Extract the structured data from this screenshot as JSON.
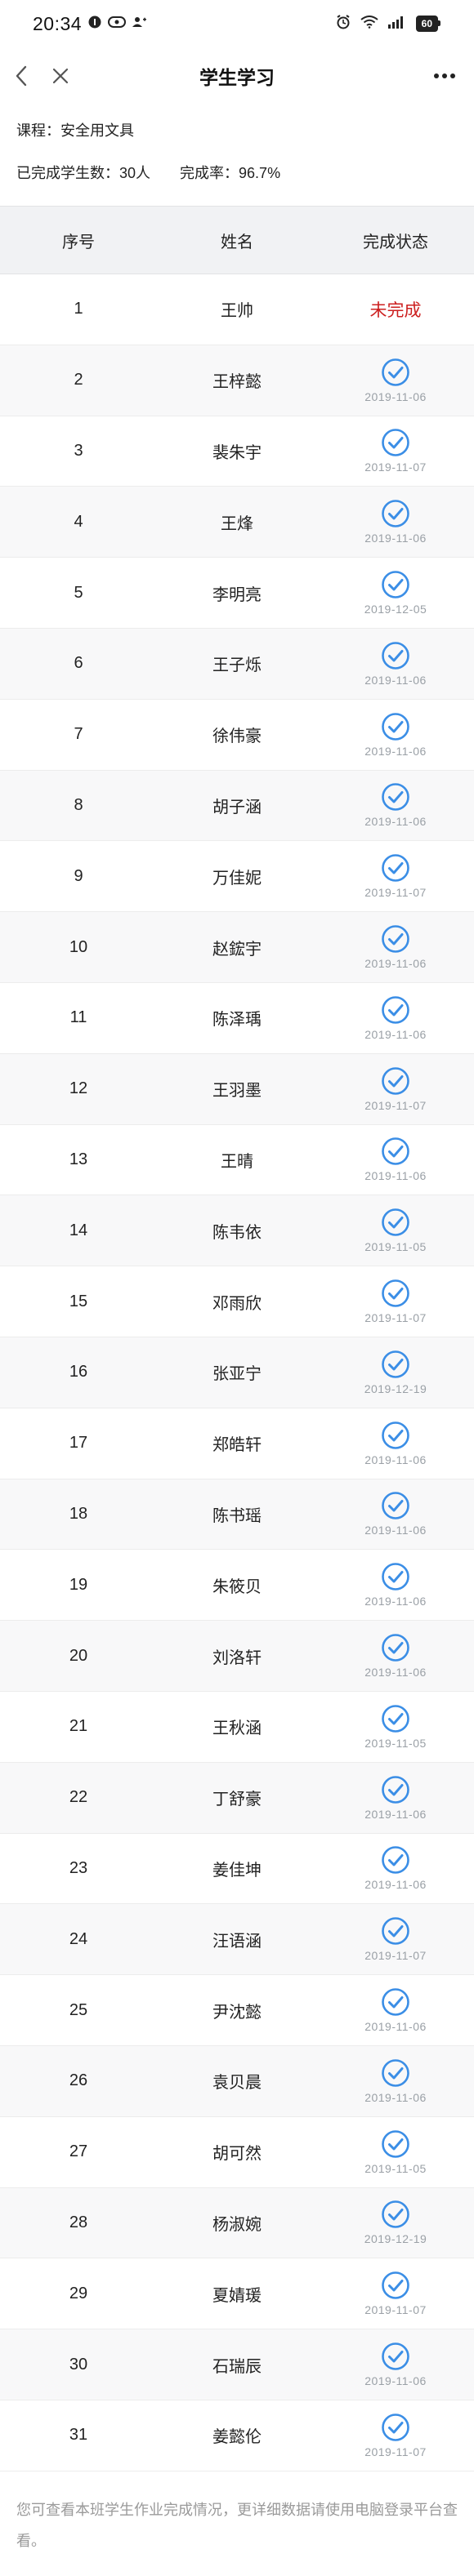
{
  "status_bar": {
    "time": "20:34",
    "battery": "60"
  },
  "nav": {
    "title": "学生学习"
  },
  "course": {
    "label": "课程：",
    "name": "安全用文具"
  },
  "summary": {
    "completed_label": "已完成学生数：",
    "completed_value": "30人",
    "rate_label": "完成率：",
    "rate_value": "96.7%"
  },
  "table": {
    "headers": {
      "no": "序号",
      "name": "姓名",
      "status": "完成状态"
    },
    "incomplete_label": "未完成",
    "rows": [
      {
        "no": "1",
        "name": "王帅",
        "done": false,
        "date": ""
      },
      {
        "no": "2",
        "name": "王梓懿",
        "done": true,
        "date": "2019-11-06"
      },
      {
        "no": "3",
        "name": "裴朱宇",
        "done": true,
        "date": "2019-11-07"
      },
      {
        "no": "4",
        "name": "王烽",
        "done": true,
        "date": "2019-11-06"
      },
      {
        "no": "5",
        "name": "李明亮",
        "done": true,
        "date": "2019-12-05"
      },
      {
        "no": "6",
        "name": "王子烁",
        "done": true,
        "date": "2019-11-06"
      },
      {
        "no": "7",
        "name": "徐伟豪",
        "done": true,
        "date": "2019-11-06"
      },
      {
        "no": "8",
        "name": "胡子涵",
        "done": true,
        "date": "2019-11-06"
      },
      {
        "no": "9",
        "name": "万佳妮",
        "done": true,
        "date": "2019-11-07"
      },
      {
        "no": "10",
        "name": "赵鋐宇",
        "done": true,
        "date": "2019-11-06"
      },
      {
        "no": "11",
        "name": "陈泽瑀",
        "done": true,
        "date": "2019-11-06"
      },
      {
        "no": "12",
        "name": "王羽墨",
        "done": true,
        "date": "2019-11-07"
      },
      {
        "no": "13",
        "name": "王晴",
        "done": true,
        "date": "2019-11-06"
      },
      {
        "no": "14",
        "name": "陈韦依",
        "done": true,
        "date": "2019-11-05"
      },
      {
        "no": "15",
        "name": "邓雨欣",
        "done": true,
        "date": "2019-11-07"
      },
      {
        "no": "16",
        "name": "张亚宁",
        "done": true,
        "date": "2019-12-19"
      },
      {
        "no": "17",
        "name": "郑皓轩",
        "done": true,
        "date": "2019-11-06"
      },
      {
        "no": "18",
        "name": "陈书瑶",
        "done": true,
        "date": "2019-11-06"
      },
      {
        "no": "19",
        "name": "朱筱贝",
        "done": true,
        "date": "2019-11-06"
      },
      {
        "no": "20",
        "name": "刘洛轩",
        "done": true,
        "date": "2019-11-06"
      },
      {
        "no": "21",
        "name": "王秋涵",
        "done": true,
        "date": "2019-11-05"
      },
      {
        "no": "22",
        "name": "丁舒豪",
        "done": true,
        "date": "2019-11-06"
      },
      {
        "no": "23",
        "name": "姜佳坤",
        "done": true,
        "date": "2019-11-06"
      },
      {
        "no": "24",
        "name": "汪语涵",
        "done": true,
        "date": "2019-11-07"
      },
      {
        "no": "25",
        "name": "尹沈懿",
        "done": true,
        "date": "2019-11-06"
      },
      {
        "no": "26",
        "name": "袁贝晨",
        "done": true,
        "date": "2019-11-06"
      },
      {
        "no": "27",
        "name": "胡可然",
        "done": true,
        "date": "2019-11-05"
      },
      {
        "no": "28",
        "name": "杨淑婉",
        "done": true,
        "date": "2019-12-19"
      },
      {
        "no": "29",
        "name": "夏婧瑗",
        "done": true,
        "date": "2019-11-07"
      },
      {
        "no": "30",
        "name": "石瑞辰",
        "done": true,
        "date": "2019-11-06"
      },
      {
        "no": "31",
        "name": "姜懿伦",
        "done": true,
        "date": "2019-11-07"
      }
    ]
  },
  "footer": {
    "note": "您可查看本班学生作业完成情况，更详细数据请使用电脑登录平台查看。"
  },
  "colors": {
    "accent_blue": "#3b8ee6",
    "incomplete_red": "#cc1f1f",
    "header_bg": "#f1f2f4"
  },
  "icons": [
    "back-arrow-icon",
    "close-icon",
    "more-icon",
    "check-circle-icon"
  ]
}
